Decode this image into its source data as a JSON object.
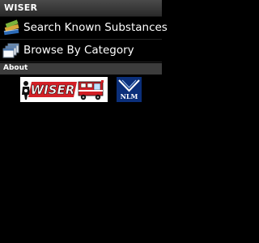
{
  "app": {
    "title": "WISER"
  },
  "menu": {
    "search_label": "Search Known Substances",
    "browse_label": "Browse By Category"
  },
  "about": {
    "header": "About",
    "wiser_logo_text": "WISER",
    "nlm_logo_text": "NLM"
  },
  "colors": {
    "background": "#000000",
    "title_bar": "#333333",
    "section_header": "#3c3c3c",
    "logo_red": "#d31f26",
    "nlm_blue": "#0b2f7a"
  },
  "icons": {
    "search": "books-icon",
    "browse": "stacked-windows-icon"
  }
}
